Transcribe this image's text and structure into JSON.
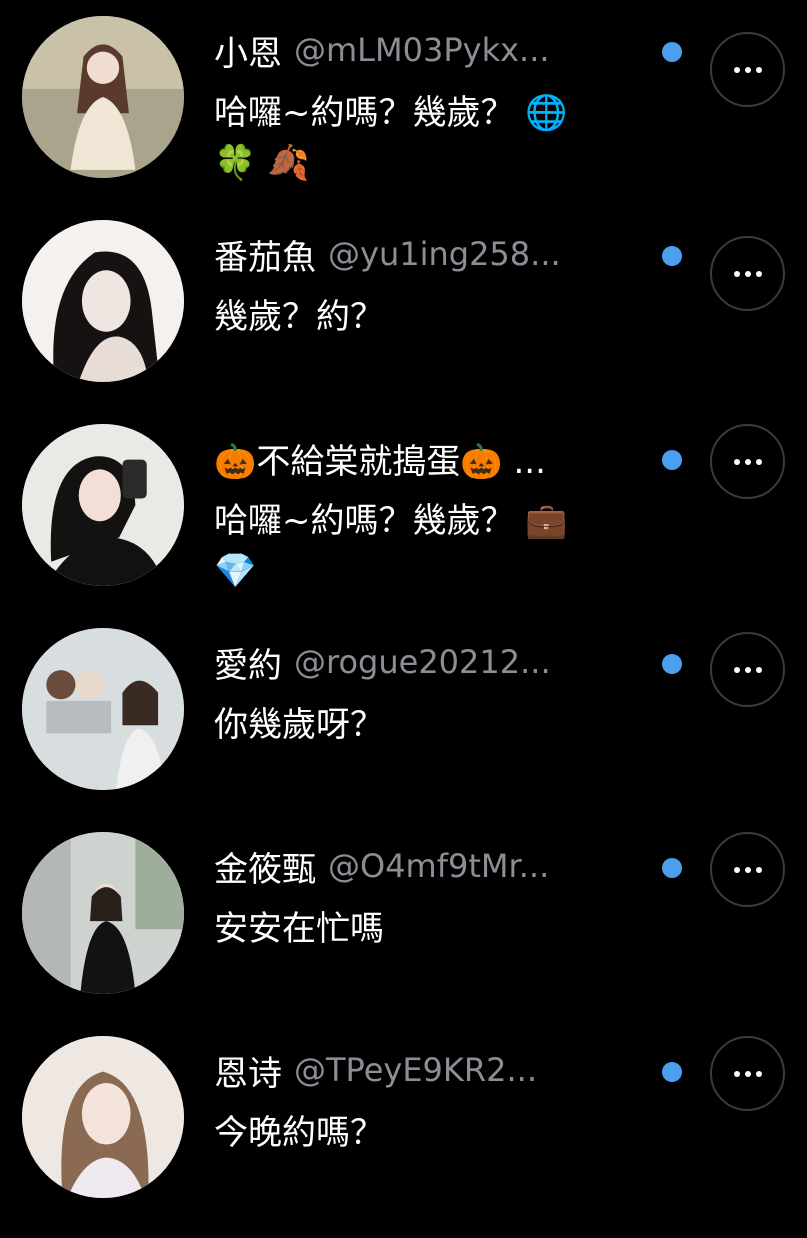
{
  "replies": [
    {
      "name": "小恩",
      "handle": "@mLM03Pykx...",
      "text": "哈囉~約嗎？幾歲？",
      "text_line2": "",
      "emoji_inline": "🌐",
      "emoji_line2": "🍀 🍂",
      "avatar_colors": {
        "bg": "#b9b29a",
        "fg": "#f2e9dc"
      }
    },
    {
      "name": "番茄魚",
      "handle": "@yu1ing258...",
      "text": "幾歲？約？",
      "text_line2": "",
      "emoji_inline": "",
      "emoji_line2": "",
      "avatar_colors": {
        "bg": "#f4f1ef",
        "fg": "#1b1717"
      }
    },
    {
      "name": "🎃不給棠就搗蛋🎃 ...",
      "handle": "",
      "text": "哈囉~約嗎？幾歲？",
      "text_line2": "",
      "emoji_inline": "💼",
      "emoji_line2": "💎",
      "avatar_colors": {
        "bg": "#e9e7e4",
        "fg": "#121212"
      }
    },
    {
      "name": "愛約",
      "handle": "@rogue20212...",
      "text": "你幾歲呀？",
      "text_line2": "",
      "emoji_inline": "",
      "emoji_line2": "",
      "avatar_colors": {
        "bg": "#d9dde0",
        "fg": "#e7d6c9"
      }
    },
    {
      "name": "金筱甄",
      "handle": "@O4mf9tMr...",
      "text": "安安在忙嗎",
      "text_line2": "",
      "emoji_inline": "",
      "emoji_line2": "",
      "avatar_colors": {
        "bg": "#cfd2cf",
        "fg": "#141414"
      }
    },
    {
      "name": "恩诗",
      "handle": "@TPeyE9KR2...",
      "text": "今晚約嗎？",
      "text_line2": "",
      "emoji_inline": "",
      "emoji_line2": "",
      "avatar_colors": {
        "bg": "#efe9e4",
        "fg": "#8a6a52"
      }
    }
  ],
  "colors": {
    "background": "#000000",
    "verified": "#4c9fef",
    "handle": "#8b8f95",
    "more_border": "#3a3b3d"
  },
  "icons": {
    "more": "more-horizontal-icon",
    "verified": "verified-dot-icon"
  }
}
